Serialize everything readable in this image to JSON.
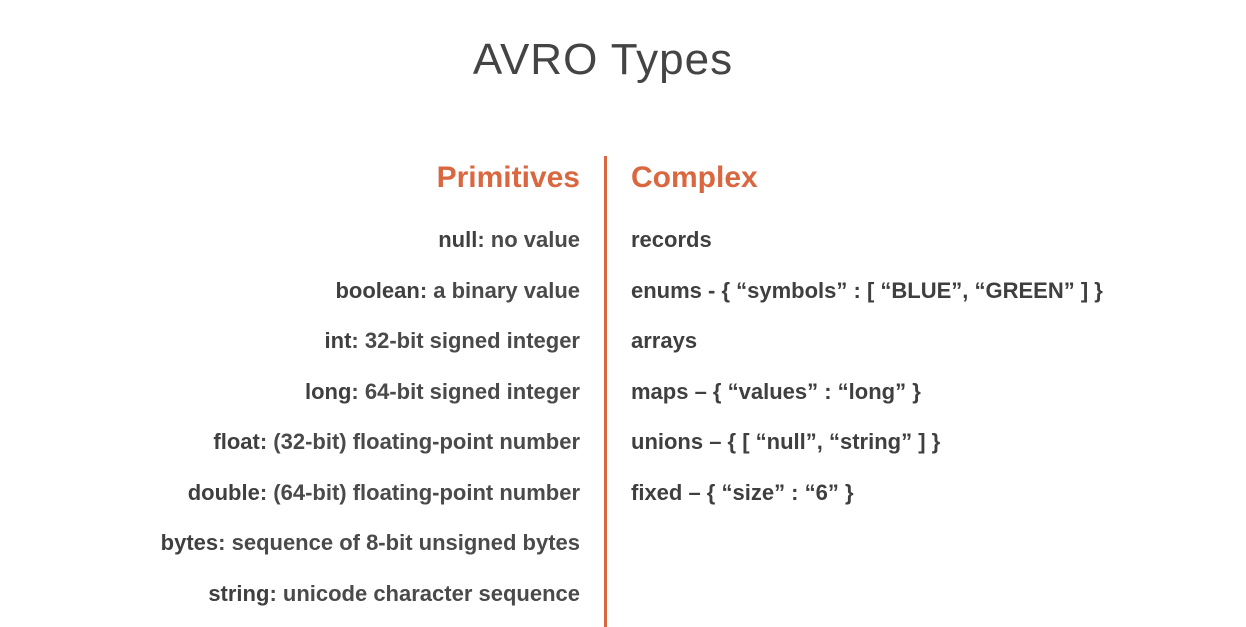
{
  "title": "AVRO Types",
  "primitives": {
    "heading": "Primitives",
    "items": [
      {
        "term": "null",
        "desc": ": no value"
      },
      {
        "term": "boolean",
        "desc": ": a binary value"
      },
      {
        "term": "int",
        "desc": ": 32-bit signed integer"
      },
      {
        "term": "long",
        "desc": ": 64-bit signed integer"
      },
      {
        "term": "float",
        "desc": ": (32-bit) floating-point number"
      },
      {
        "term": "double",
        "desc": ": (64-bit) floating-point number"
      },
      {
        "term": "bytes",
        "desc": ": sequence of 8-bit unsigned bytes"
      },
      {
        "term": "string",
        "desc": ": unicode character sequence"
      }
    ]
  },
  "complex": {
    "heading": "Complex",
    "items": [
      "records",
      "enums -  { “symbols” : [ “BLUE”, “GREEN” ] }",
      "arrays",
      "maps –  { “values” : “long” }",
      "unions – { [ “null”, “string” ] }",
      "fixed – { “size” : “6” }"
    ]
  },
  "colors": {
    "accent": "#d9673f",
    "text": "#404040",
    "background": "#ffffff"
  }
}
